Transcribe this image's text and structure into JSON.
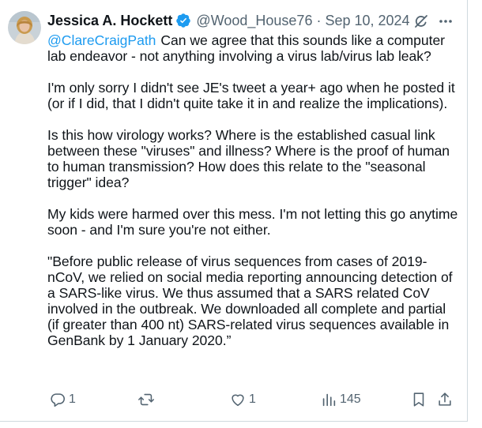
{
  "tweet": {
    "author_name": "Jessica A. Hockett",
    "handle": "@Wood_House76",
    "separator": "·",
    "date": "Sep 10, 2024",
    "mention": "@ClareCraigPath",
    "paragraphs": [
      "Can we agree that this sounds like a computer lab endeavor - not anything involving a virus lab/virus lab leak?",
      "I'm only sorry I didn't see JE's tweet a year+ ago when he posted it (or if I did, that I didn't quite take it in and realize the implications).",
      "Is this how virology works? Where is the established casual link between these \"viruses\" and illness? Where is the proof of human to human transmission? How does this relate to the \"seasonal trigger\" idea?",
      "My kids were harmed over this mess. I'm not letting this go anytime soon - and I'm sure you're not either.",
      "\"Before public release of virus sequences from cases of 2019-nCoV, we relied on social media reporting announcing detection of a SARS-like virus. We thus assumed that a SARS related CoV involved in the outbreak. We downloaded all complete and partial (if greater than 400 nt) SARS-related virus sequences available in GenBank by 1 January 2020.”"
    ],
    "icons": {
      "verified": "verified-badge-icon",
      "grok": "grok-icon",
      "more": "more-icon",
      "reply": "reply-icon",
      "repost": "repost-icon",
      "like": "like-icon",
      "views": "views-icon",
      "bookmark": "bookmark-icon",
      "share": "share-icon"
    },
    "colors": {
      "link": "#1d9bf0",
      "secondary_text": "#536471",
      "verified": "#1d9bf0"
    }
  },
  "actions": {
    "reply_count": "1",
    "repost_count": "",
    "like_count": "1",
    "views_count": "145"
  }
}
